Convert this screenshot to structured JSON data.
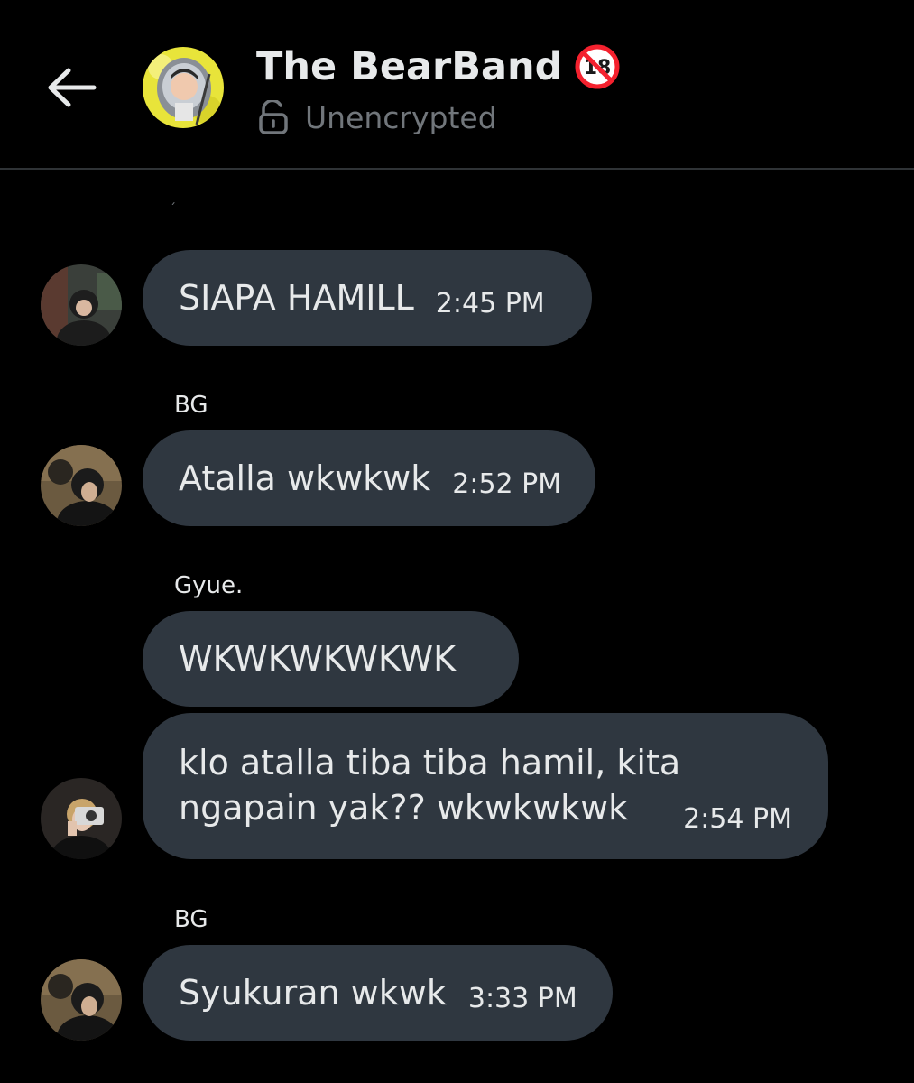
{
  "header": {
    "title": "The BearBand",
    "age_badge_text": "18",
    "encryption_status": "Unencrypted"
  },
  "stray_mark": "´",
  "messages": [
    {
      "sender": "",
      "text": "SIAPA HAMILL",
      "time": "2:45 PM"
    },
    {
      "sender": "BG",
      "text": "Atalla wkwkwk",
      "time": "2:52 PM"
    },
    {
      "sender": "Gyue.",
      "text": "WKWKWKWKWK",
      "time": ""
    },
    {
      "sender": "",
      "text": "klo atalla tiba tiba hamil, kita ngapain yak?? wkwkwkwk",
      "time": "2:54 PM"
    },
    {
      "sender": "BG",
      "text": "Syukuran wkwk",
      "time": "3:33 PM"
    }
  ],
  "colors": {
    "background": "#000000",
    "bubble": "#2f3740",
    "text": "#e7e9ea",
    "muted": "#71767b",
    "divider": "#2f3336",
    "badge_red": "#f4212e"
  }
}
